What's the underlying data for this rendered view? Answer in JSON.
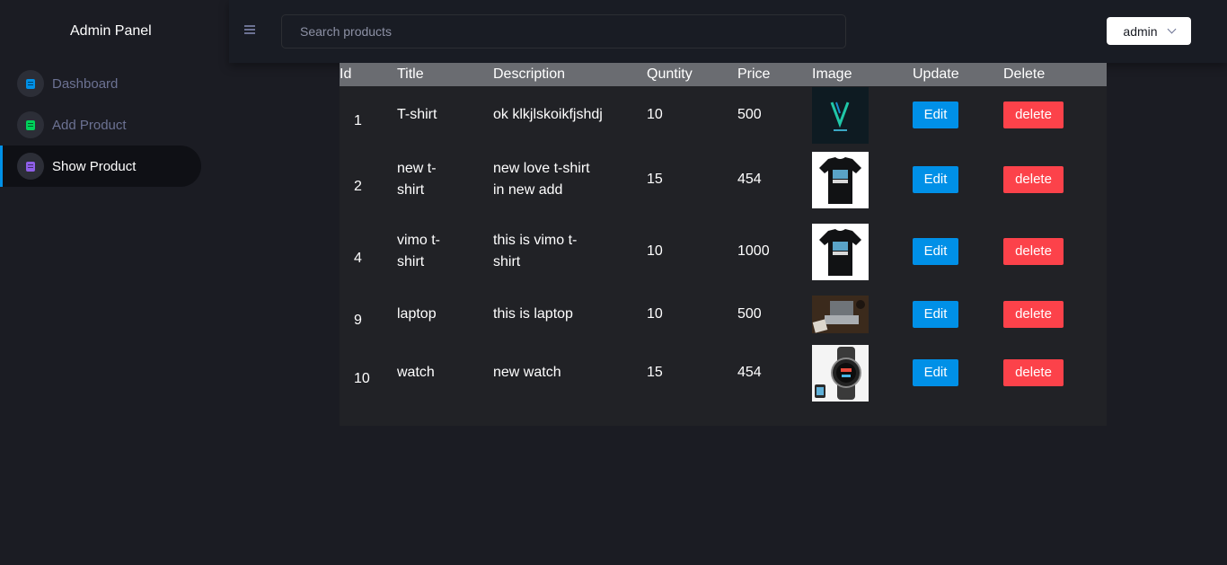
{
  "sidebar": {
    "brand": "Admin Panel",
    "items": [
      {
        "label": "Dashboard",
        "icon": "dashboard-icon",
        "color": "#0090e7",
        "active": false
      },
      {
        "label": "Add Product",
        "icon": "add-product-icon",
        "color": "#00d25b",
        "active": false
      },
      {
        "label": "Show Product",
        "icon": "show-product-icon",
        "color": "#8f5fe8",
        "active": true
      }
    ]
  },
  "header": {
    "menu_icon": "hamburger-menu-icon",
    "search_placeholder": "Search products",
    "user_label": "admin",
    "user_icon": "chevron-down-icon"
  },
  "table": {
    "headers": [
      "Id",
      "Title",
      "Description",
      "Quntity",
      "Price",
      "Image",
      "Update",
      "Delete"
    ],
    "rows": [
      {
        "id": "1",
        "title": "T-shirt",
        "description": "ok klkjlskoikfjshdj",
        "quantity": "10",
        "price": "500",
        "image": "vimo-logo-image",
        "edit": "Edit",
        "delete": "delete"
      },
      {
        "id": "2",
        "title": "new t-shirt",
        "description": "new love t-shirt in new add",
        "quantity": "15",
        "price": "454",
        "image": "black-tshirt-image",
        "edit": "Edit",
        "delete": "delete"
      },
      {
        "id": "4",
        "title": "vimo t-shirt",
        "description": "this is vimo t-shirt",
        "quantity": "10",
        "price": "1000",
        "image": "black-tshirt-image",
        "edit": "Edit",
        "delete": "delete"
      },
      {
        "id": "9",
        "title": "laptop",
        "description": "this is laptop",
        "quantity": "10",
        "price": "500",
        "image": "laptop-image",
        "edit": "Edit",
        "delete": "delete"
      },
      {
        "id": "10",
        "title": "watch",
        "description": "new watch",
        "quantity": "15",
        "price": "454",
        "image": "smartwatch-image",
        "edit": "Edit",
        "delete": "delete"
      }
    ]
  },
  "colors": {
    "background": "#1b1c23",
    "edit_button": "#0090e7",
    "delete_button": "#fc424a",
    "table_header": "#6a6c71"
  }
}
